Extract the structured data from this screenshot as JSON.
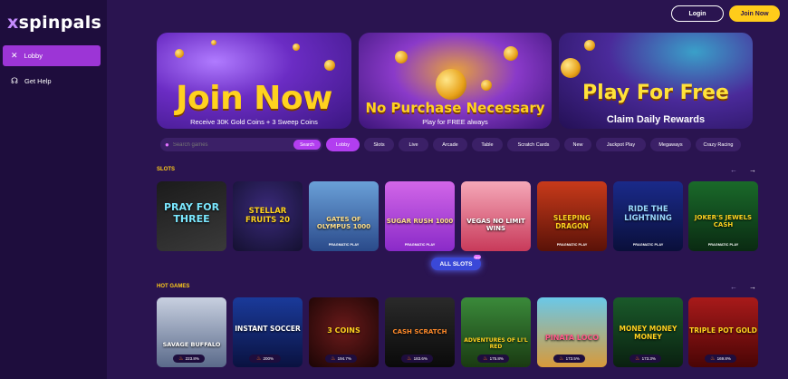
{
  "brand": {
    "logo_prefix": "x",
    "logo_text": "spinpals"
  },
  "sidebar": {
    "items": [
      {
        "label": "Lobby",
        "icon": "x-icon",
        "active": true
      },
      {
        "label": "Get Help",
        "icon": "headset-icon",
        "active": false
      }
    ]
  },
  "header": {
    "login_label": "Login",
    "join_label": "Join Now"
  },
  "banners": [
    {
      "headline": "Join Now",
      "subtext": "Receive 30K Gold Coins + 3 Sweep Coins"
    },
    {
      "headline": "No Purchase Necessary",
      "subtext": "Play for FREE always"
    },
    {
      "headline": "Play For Free",
      "subtext": "Claim Daily Rewards"
    }
  ],
  "search": {
    "placeholder": "Search games",
    "button_label": "Search"
  },
  "filters": [
    "Lobby",
    "Slots",
    "Live",
    "Arcade",
    "Table",
    "Scratch Cards",
    "New",
    "Jackpot Play",
    "Megaways",
    "Crazy Racing"
  ],
  "slots": {
    "title": "SLOTS",
    "games": [
      {
        "name": "PRAY FOR THREE",
        "maker": ""
      },
      {
        "name": "STELLAR FRUITS 20",
        "maker": ""
      },
      {
        "name": "GATES OF OLYMPUS 1000",
        "maker": "PRAGMATIC PLAY"
      },
      {
        "name": "SUGAR RUSH 1000",
        "maker": "PRAGMATIC PLAY"
      },
      {
        "name": "VEGAS NO LIMIT WINS",
        "maker": ""
      },
      {
        "name": "SLEEPING DRAGON",
        "maker": "PRAGMATIC PLAY"
      },
      {
        "name": "RIDE THE LIGHTNING",
        "maker": "PRAGMATIC PLAY"
      },
      {
        "name": "JOKER'S JEWELS CASH",
        "maker": "PRAGMATIC PLAY"
      }
    ],
    "all_label": "ALL SLOTS",
    "new_badge": "NEW"
  },
  "hot": {
    "title": "HOT GAMES",
    "games": [
      {
        "name": "SAVAGE BUFFALO",
        "pct": "223.8%"
      },
      {
        "name": "INSTANT SOCCER",
        "pct": "200%"
      },
      {
        "name": "3 COINS",
        "pct": "194.7%"
      },
      {
        "name": "CASH SCRATCH",
        "pct": "183.6%"
      },
      {
        "name": "ADVENTURES OF LI'L RED",
        "pct": "175.8%"
      },
      {
        "name": "PINATA LOCO",
        "pct": "173.5%"
      },
      {
        "name": "MONEY MONEY MONEY",
        "pct": "173.3%"
      },
      {
        "name": "TRIPLE POT GOLD",
        "pct": "169.8%"
      }
    ]
  },
  "colors": {
    "accent": "#b23ef0",
    "cta": "#ffcc1a",
    "bg": "#2a1450",
    "sidebar": "#1e0d3d"
  }
}
